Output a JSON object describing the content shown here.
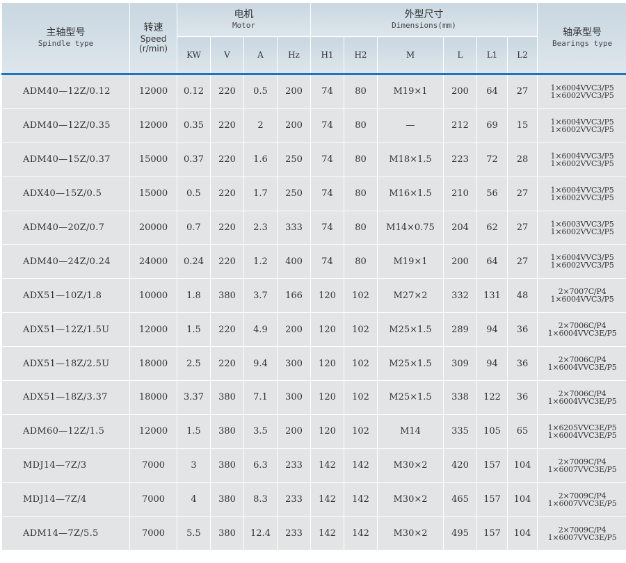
{
  "header": {
    "model": {
      "cn": "主轴型号",
      "en": "Spindle type"
    },
    "speed": {
      "cn": "转速",
      "en": "Speed",
      "unit": "(r/min)"
    },
    "motor": {
      "cn": "电机",
      "en": "Motor"
    },
    "dims": {
      "cn": "外型尺寸",
      "en": "Dimensions(mm)"
    },
    "bearings": {
      "cn": "轴承型号",
      "en": "Bearings type"
    },
    "sub": [
      "KW",
      "V",
      "A",
      "Hz",
      "H1",
      "H2",
      "M",
      "L",
      "L1",
      "L2"
    ]
  },
  "rows": [
    {
      "model": "ADM40—12Z/0.12",
      "speed": "12000",
      "kw": "0.12",
      "v": "220",
      "a": "0.5",
      "hz": "200",
      "h1": "74",
      "h2": "80",
      "m": "M19×1",
      "l": "200",
      "l1": "64",
      "l2": "27",
      "b1": "1×6004VVC3/P5",
      "b2": "1×6002VVC3/P5"
    },
    {
      "model": "ADM40—12Z/0.35",
      "speed": "12000",
      "kw": "0.35",
      "v": "220",
      "a": "2",
      "hz": "200",
      "h1": "74",
      "h2": "80",
      "m": "—",
      "l": "212",
      "l1": "69",
      "l2": "15",
      "b1": "1×6004VVC3/P5",
      "b2": "1×6002VVC3/P5"
    },
    {
      "model": "ADM40—15Z/0.37",
      "speed": "15000",
      "kw": "0.37",
      "v": "220",
      "a": "1.6",
      "hz": "250",
      "h1": "74",
      "h2": "80",
      "m": "M18×1.5",
      "l": "223",
      "l1": "72",
      "l2": "28",
      "b1": "1×6004VVC3/P5",
      "b2": "1×6002VVC3/P5"
    },
    {
      "model": "ADX40—15Z/0.5",
      "speed": "15000",
      "kw": "0.5",
      "v": "220",
      "a": "1.7",
      "hz": "250",
      "h1": "74",
      "h2": "80",
      "m": "M16×1.5",
      "l": "210",
      "l1": "56",
      "l2": "27",
      "b1": "1×6004VVC3/P5",
      "b2": "1×6002VVC3/P5"
    },
    {
      "model": "ADM40—20Z/0.7",
      "speed": "20000",
      "kw": "0.7",
      "v": "220",
      "a": "2.3",
      "hz": "333",
      "h1": "74",
      "h2": "80",
      "m": "M14×0.75",
      "l": "204",
      "l1": "62",
      "l2": "27",
      "b1": "1×6003VVC3/P5",
      "b2": "1×6002VVC3/P5"
    },
    {
      "model": "ADM40—24Z/0.24",
      "speed": "24000",
      "kw": "0.24",
      "v": "220",
      "a": "1.2",
      "hz": "400",
      "h1": "74",
      "h2": "80",
      "m": "M19×1",
      "l": "200",
      "l1": "64",
      "l2": "27",
      "b1": "1×6004VVC3/P5",
      "b2": "1×6002VVC3/P5"
    },
    {
      "model": "ADX51—10Z/1.8",
      "speed": "10000",
      "kw": "1.8",
      "v": "380",
      "a": "3.7",
      "hz": "166",
      "h1": "120",
      "h2": "102",
      "m": "M27×2",
      "l": "332",
      "l1": "131",
      "l2": "48",
      "b1": "2×7007C/P4",
      "b2": "1×6004VVC3/P5"
    },
    {
      "model": "ADX51—12Z/1.5U",
      "speed": "12000",
      "kw": "1.5",
      "v": "220",
      "a": "4.9",
      "hz": "200",
      "h1": "120",
      "h2": "102",
      "m": "M25×1.5",
      "l": "289",
      "l1": "94",
      "l2": "36",
      "b1": "2×7006C/P4",
      "b2": "1×6004VVC3E/P5"
    },
    {
      "model": "ADX51—18Z/2.5U",
      "speed": "18000",
      "kw": "2.5",
      "v": "220",
      "a": "9.4",
      "hz": "300",
      "h1": "120",
      "h2": "102",
      "m": "M25×1.5",
      "l": "309",
      "l1": "94",
      "l2": "36",
      "b1": "2×7006C/P4",
      "b2": "1×6004VVC3E/P5"
    },
    {
      "model": "ADX51—18Z/3.37",
      "speed": "18000",
      "kw": "3.37",
      "v": "380",
      "a": "7.1",
      "hz": "300",
      "h1": "120",
      "h2": "102",
      "m": "M25×1.5",
      "l": "338",
      "l1": "122",
      "l2": "36",
      "b1": "2×7006C/P4",
      "b2": "1×6004VVC3E/P5"
    },
    {
      "model": "ADM60—12Z/1.5",
      "speed": "12000",
      "kw": "1.5",
      "v": "380",
      "a": "3.5",
      "hz": "200",
      "h1": "120",
      "h2": "102",
      "m": "M14",
      "l": "335",
      "l1": "105",
      "l2": "65",
      "b1": "1×6205VVC3E/P5",
      "b2": "1×6004VVC3E/P5"
    },
    {
      "model": "MDJ14—7Z/3",
      "speed": "7000",
      "kw": "3",
      "v": "380",
      "a": "6.3",
      "hz": "233",
      "h1": "142",
      "h2": "142",
      "m": "M30×2",
      "l": "420",
      "l1": "157",
      "l2": "104",
      "b1": "2×7009C/P4",
      "b2": "1×6007VVC3E/P5"
    },
    {
      "model": "MDJ14—7Z/4",
      "speed": "7000",
      "kw": "4",
      "v": "380",
      "a": "8.3",
      "hz": "233",
      "h1": "142",
      "h2": "142",
      "m": "M30×2",
      "l": "465",
      "l1": "157",
      "l2": "104",
      "b1": "2×7009C/P4",
      "b2": "1×6007VVC3E/P5"
    },
    {
      "model": "ADM14—7Z/5.5",
      "speed": "7000",
      "kw": "5.5",
      "v": "380",
      "a": "12.4",
      "hz": "233",
      "h1": "142",
      "h2": "142",
      "m": "M30×2",
      "l": "495",
      "l1": "157",
      "l2": "104",
      "b1": "2×7009C/P4",
      "b2": "1×6007VVC3E/P5"
    }
  ]
}
